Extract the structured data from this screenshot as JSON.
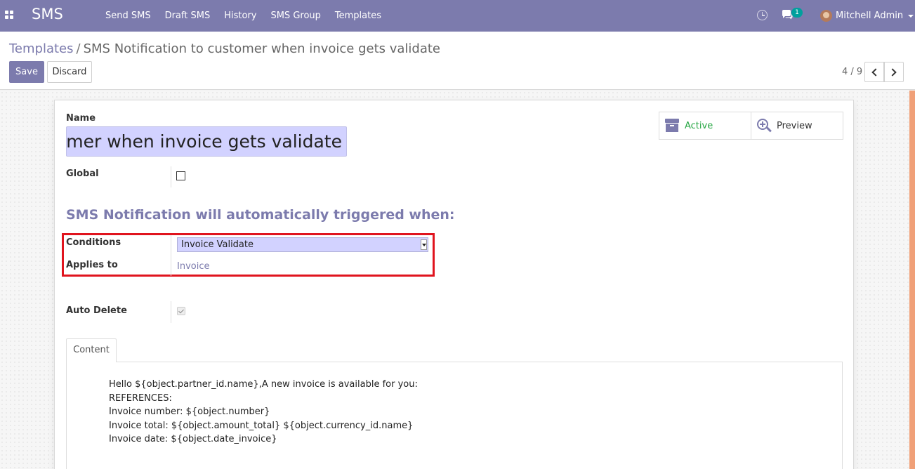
{
  "navbar": {
    "brand": "SMS",
    "menu": [
      {
        "label": "Send SMS"
      },
      {
        "label": "Draft SMS"
      },
      {
        "label": "History"
      },
      {
        "label": "SMS Group"
      },
      {
        "label": "Templates"
      }
    ],
    "chat_badge": "1",
    "user_name": "Mitchell Admin"
  },
  "breadcrumb": {
    "parent": "Templates",
    "separator": "/",
    "current": "SMS Notification to customer when invoice gets validate"
  },
  "toolbar": {
    "save_label": "Save",
    "discard_label": "Discard"
  },
  "pager": {
    "value": "4 / 9"
  },
  "form": {
    "name_label": "Name",
    "name_value": "SMS Notification to customer when invoice gets validate",
    "stat_buttons": {
      "active_label": "Active",
      "preview_label": "Preview"
    },
    "global_label": "Global",
    "global_checked": false,
    "section_title": "SMS Notification will automatically triggered when:",
    "conditions_label": "Conditions",
    "conditions_value": "Invoice Validate",
    "applies_to_label": "Applies to",
    "applies_to_value": "Invoice",
    "auto_delete_label": "Auto Delete",
    "auto_delete_checked": true,
    "tab_label": "Content",
    "content_lines": [
      "Hello ${object.partner_id.name},A new invoice is available for you:",
      "REFERENCES:",
      "Invoice number: ${object.number}",
      "Invoice total: ${object.amount_total} ${object.currency_id.name}",
      "Invoice date: ${object.date_invoice}"
    ]
  },
  "colors": {
    "brand": "#7c7bad",
    "active_green": "#28a745",
    "highlight_red": "#e0141e",
    "input_bg": "#d2d2ff"
  }
}
